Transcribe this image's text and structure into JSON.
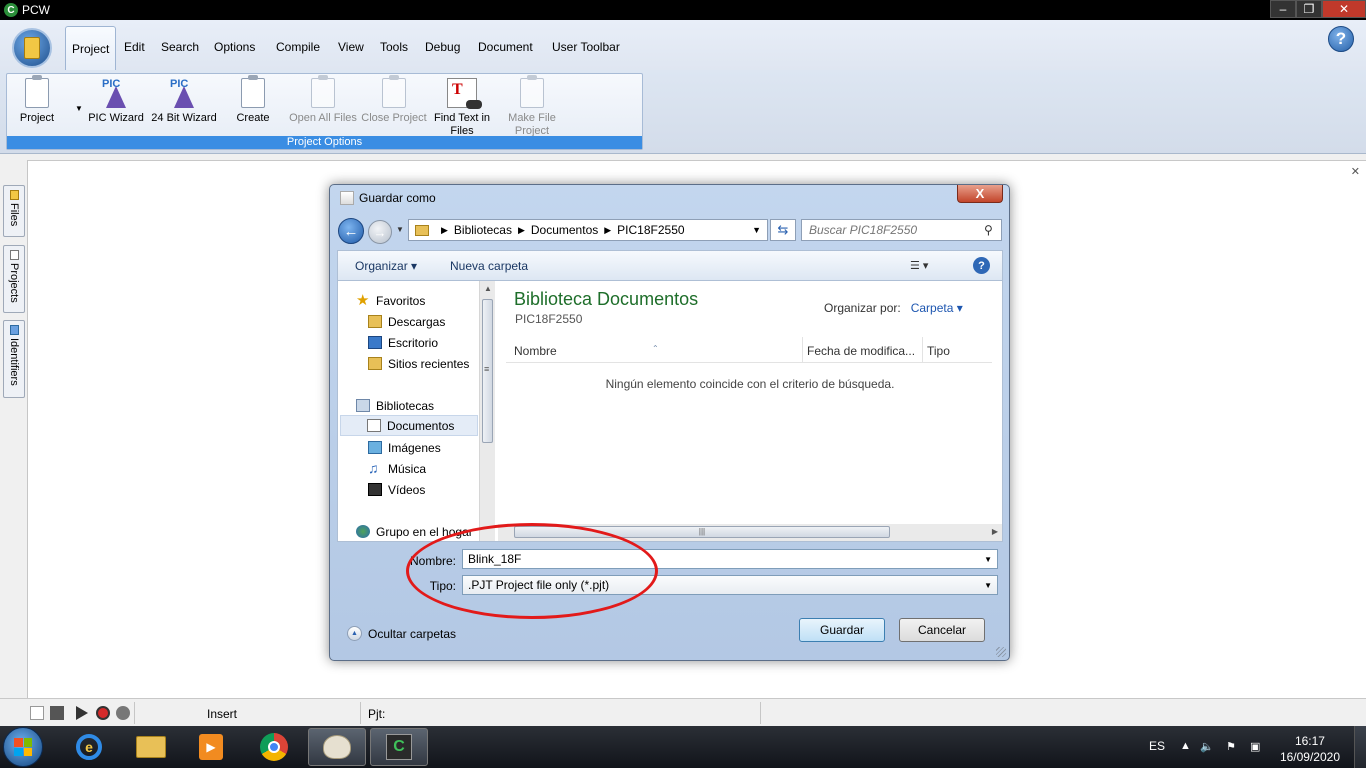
{
  "window": {
    "title": "PCW"
  },
  "menu": {
    "tabs": [
      "Project",
      "Edit",
      "Search",
      "Options",
      "Compile",
      "View",
      "Tools",
      "Debug",
      "Document",
      "User Toolbar"
    ],
    "active": "Project",
    "help_label": "?"
  },
  "ribbon": {
    "group_label": "Project Options",
    "items": [
      {
        "label": "Project",
        "enabled": true,
        "icon": "clipboard-icon"
      },
      {
        "label": "PIC Wizard",
        "enabled": true,
        "icon": "pic-wizard-icon"
      },
      {
        "label": "24 Bit Wizard",
        "enabled": true,
        "icon": "pic-wizard-icon"
      },
      {
        "label": "Create",
        "enabled": true,
        "icon": "clipboard-icon"
      },
      {
        "label": "Open All Files",
        "enabled": false,
        "icon": "clipboard-icon"
      },
      {
        "label": "Close Project",
        "enabled": false,
        "icon": "clipboard-icon"
      },
      {
        "label": "Find Text in Files",
        "enabled": true,
        "icon": "find-text-icon"
      },
      {
        "label": "Make File Project",
        "enabled": false,
        "icon": "clipboard-icon"
      }
    ],
    "pic_text": "PIC"
  },
  "sidebar": {
    "tabs": [
      "Files",
      "Projects",
      "Identifiers"
    ]
  },
  "dialog": {
    "title": "Guardar como",
    "close_label": "X",
    "breadcrumb": [
      "Bibliotecas",
      "Documentos",
      "PIC18F2550"
    ],
    "search_placeholder": "Buscar PIC18F2550",
    "toolbar": {
      "organize": "Organizar",
      "new_folder": "Nueva carpeta"
    },
    "nav": {
      "favorites": "Favoritos",
      "downloads": "Descargas",
      "desktop": "Escritorio",
      "recent": "Sitios recientes",
      "libraries": "Bibliotecas",
      "documents": "Documentos",
      "images": "Imágenes",
      "music": "Música",
      "videos": "Vídeos",
      "homegroup": "Grupo en el hogar"
    },
    "content": {
      "title": "Biblioteca Documentos",
      "subtitle": "PIC18F2550",
      "arrange_label": "Organizar por:",
      "arrange_value": "Carpeta",
      "columns": [
        "Nombre",
        "Fecha de modifica...",
        "Tipo"
      ],
      "empty_message": "Ningún elemento coincide con el criterio de búsqueda."
    },
    "filename_label": "Nombre:",
    "filename_value": "Blink_18F",
    "type_label": "Tipo:",
    "type_value": ".PJT Project file only (*.pjt)",
    "hide_folders": "Ocultar carpetas",
    "save_label": "Guardar",
    "cancel_label": "Cancelar"
  },
  "statusbar": {
    "mode": "Insert",
    "project": "Pjt:"
  },
  "taskbar": {
    "language": "ES",
    "time": "16:17",
    "date": "16/09/2020"
  },
  "colors": {
    "accent": "#3a8de3",
    "annotation": "#e21a1a",
    "library_title": "#1e6e2a"
  }
}
